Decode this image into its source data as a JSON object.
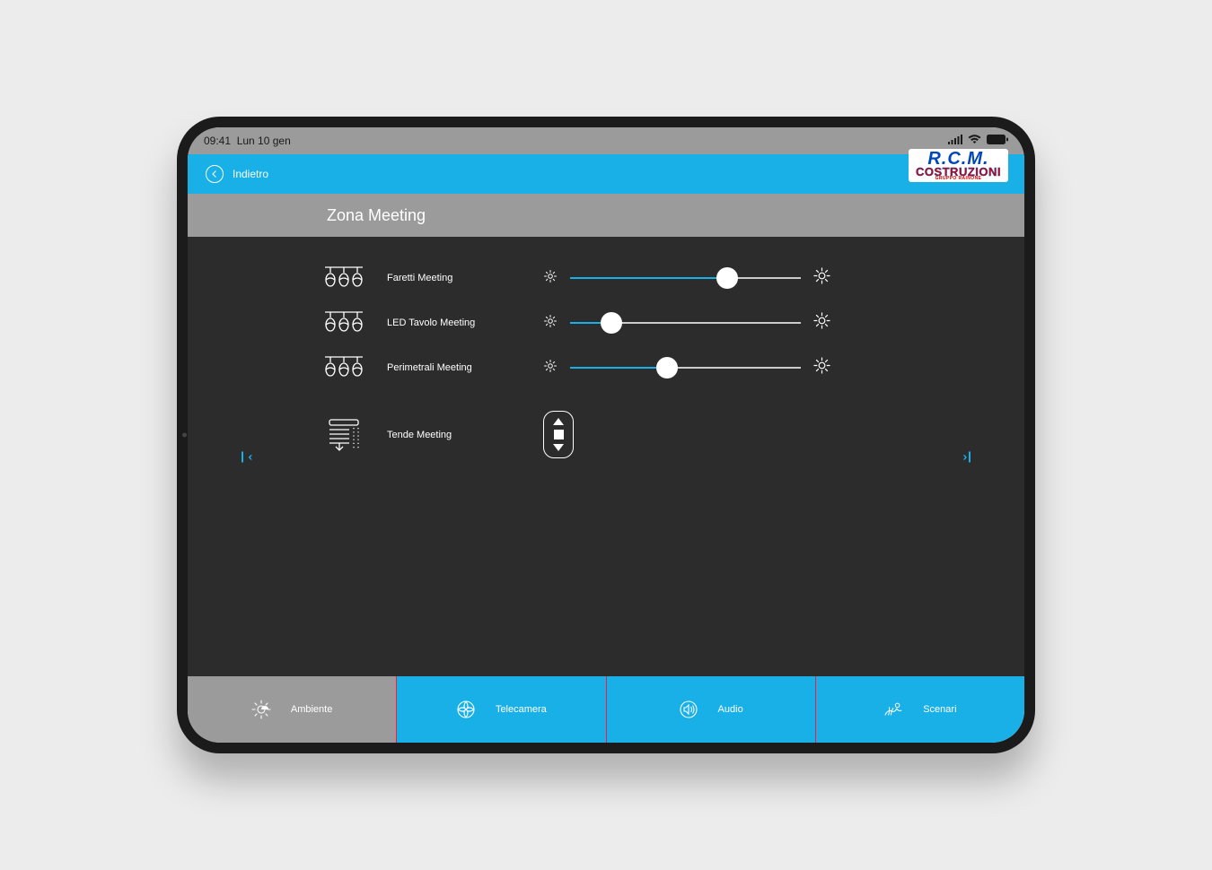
{
  "status": {
    "time": "09:41",
    "date": "Lun 10 gen"
  },
  "header": {
    "back_label": "Indietro"
  },
  "logo": {
    "line1": "R.C.M.",
    "line2": "COSTRUZIONI",
    "line3": "GRUPPO RAINONE"
  },
  "page": {
    "title": "Zona Meeting"
  },
  "sliders": [
    {
      "label": "Faretti Meeting",
      "value": 68
    },
    {
      "label": "LED Tavolo Meeting",
      "value": 18
    },
    {
      "label": "Perimetrali Meeting",
      "value": 42
    }
  ],
  "blinds": {
    "label": "Tende Meeting"
  },
  "tabs": [
    {
      "label": "Ambiente",
      "active": false
    },
    {
      "label": "Telecamera",
      "active": true
    },
    {
      "label": "Audio",
      "active": true
    },
    {
      "label": "Scenari",
      "active": true
    }
  ],
  "colors": {
    "accent": "#19b0e8",
    "divider": "#ff1744"
  }
}
